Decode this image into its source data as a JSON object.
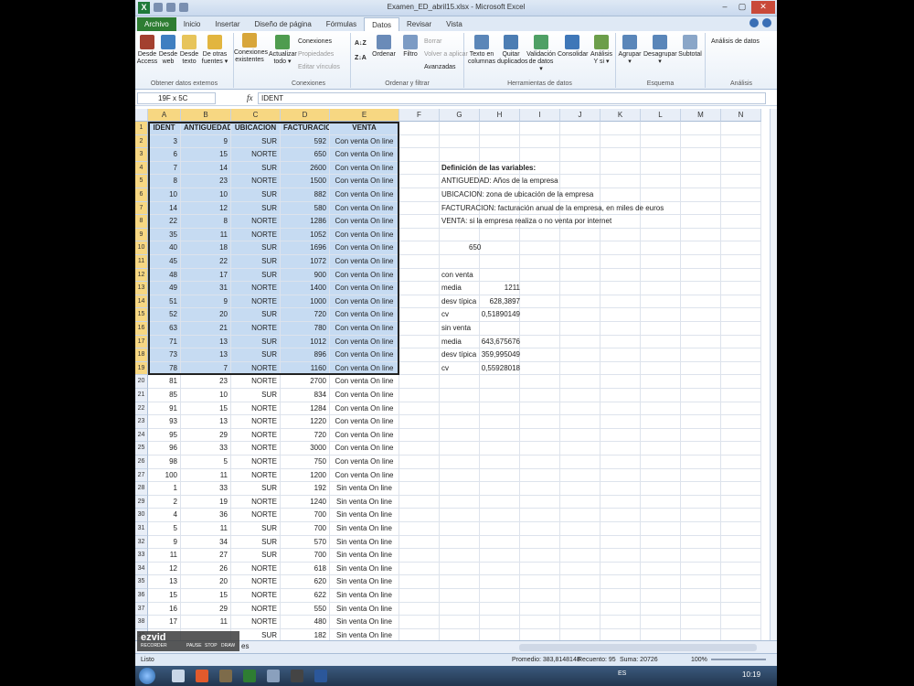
{
  "window": {
    "title": "Examen_ED_abril15.xlsx - Microsoft Excel",
    "min": "–",
    "max": "▢",
    "close": "✕"
  },
  "tabs": [
    "Archivo",
    "Inicio",
    "Insertar",
    "Diseño de página",
    "Fórmulas",
    "Datos",
    "Revisar",
    "Vista"
  ],
  "active_tab": "Datos",
  "ribbon": {
    "ext": {
      "title": "Obtener datos externos",
      "buttons": [
        {
          "l1": "Desde",
          "l2": "Access"
        },
        {
          "l1": "Desde",
          "l2": "web"
        },
        {
          "l1": "Desde",
          "l2": "texto"
        },
        {
          "l1": "De otras",
          "l2": "fuentes ▾"
        },
        {
          "l1": "Conexiones",
          "l2": "existentes"
        }
      ]
    },
    "conn": {
      "title": "Conexiones",
      "refresh1": "Actualizar",
      "refresh2": "todo ▾",
      "connections": "Conexiones",
      "properties": "Propiedades",
      "edit_links": "Editar vínculos"
    },
    "sort": {
      "title": "Ordenar y filtrar",
      "sort": "Ordenar",
      "filter": "Filtro",
      "clear": "Borrar",
      "reapply": "Volver a aplicar",
      "advanced": "Avanzadas"
    },
    "tools": {
      "title": "Herramientas de datos",
      "buttons": [
        {
          "l1": "Texto en",
          "l2": "columnas"
        },
        {
          "l1": "Quitar",
          "l2": "duplicados"
        },
        {
          "l1": "Validación",
          "l2": "de datos ▾"
        },
        {
          "l1": "Consolidar",
          "l2": ""
        },
        {
          "l1": "Análisis",
          "l2": "Y si ▾"
        }
      ]
    },
    "outline": {
      "title": "Esquema",
      "buttons": [
        {
          "l1": "Agrupar",
          "l2": "▾"
        },
        {
          "l1": "Desagrupar",
          "l2": "▾"
        },
        {
          "l1": "Subtotal",
          "l2": ""
        }
      ]
    },
    "analysis": {
      "title": "Análisis",
      "data_analysis": "Análisis de datos"
    }
  },
  "formula_bar": {
    "name_box": "19F x 5C",
    "fx": "fx",
    "content": "IDENT"
  },
  "columns": [
    "A",
    "B",
    "C",
    "D",
    "E",
    "F",
    "G",
    "H",
    "I",
    "J",
    "K",
    "L",
    "M",
    "N"
  ],
  "headers": [
    "IDENT",
    "ANTIGUEDAD",
    "UBICACION",
    "FACTURACION",
    "VENTA"
  ],
  "rows": [
    [
      "3",
      "9",
      "SUR",
      "592",
      "Con venta On line"
    ],
    [
      "6",
      "15",
      "NORTE",
      "650",
      "Con venta On line"
    ],
    [
      "7",
      "14",
      "SUR",
      "2600",
      "Con venta On line"
    ],
    [
      "8",
      "23",
      "NORTE",
      "1500",
      "Con venta On line"
    ],
    [
      "10",
      "10",
      "SUR",
      "882",
      "Con venta On line"
    ],
    [
      "14",
      "12",
      "SUR",
      "580",
      "Con venta On line"
    ],
    [
      "22",
      "8",
      "NORTE",
      "1286",
      "Con venta On line"
    ],
    [
      "35",
      "11",
      "NORTE",
      "1052",
      "Con venta On line"
    ],
    [
      "40",
      "18",
      "SUR",
      "1696",
      "Con venta On line"
    ],
    [
      "45",
      "22",
      "SUR",
      "1072",
      "Con venta On line"
    ],
    [
      "48",
      "17",
      "SUR",
      "900",
      "Con venta On line"
    ],
    [
      "49",
      "31",
      "NORTE",
      "1400",
      "Con venta On line"
    ],
    [
      "51",
      "9",
      "NORTE",
      "1000",
      "Con venta On line"
    ],
    [
      "52",
      "20",
      "SUR",
      "720",
      "Con venta On line"
    ],
    [
      "63",
      "21",
      "NORTE",
      "780",
      "Con venta On line"
    ],
    [
      "71",
      "13",
      "SUR",
      "1012",
      "Con venta On line"
    ],
    [
      "73",
      "13",
      "SUR",
      "896",
      "Con venta On line"
    ],
    [
      "78",
      "7",
      "NORTE",
      "1160",
      "Con venta On line"
    ],
    [
      "81",
      "23",
      "NORTE",
      "2700",
      "Con venta On line"
    ],
    [
      "85",
      "10",
      "SUR",
      "834",
      "Con venta On line"
    ],
    [
      "91",
      "15",
      "NORTE",
      "1284",
      "Con venta On line"
    ],
    [
      "93",
      "13",
      "NORTE",
      "1220",
      "Con venta On line"
    ],
    [
      "95",
      "29",
      "NORTE",
      "720",
      "Con venta On line"
    ],
    [
      "96",
      "33",
      "NORTE",
      "3000",
      "Con venta On line"
    ],
    [
      "98",
      "5",
      "NORTE",
      "750",
      "Con venta On line"
    ],
    [
      "100",
      "11",
      "NORTE",
      "1200",
      "Con venta On line"
    ],
    [
      "1",
      "33",
      "SUR",
      "192",
      "Sin venta On line"
    ],
    [
      "2",
      "19",
      "NORTE",
      "1240",
      "Sin venta On line"
    ],
    [
      "4",
      "36",
      "NORTE",
      "700",
      "Sin venta On line"
    ],
    [
      "5",
      "11",
      "SUR",
      "700",
      "Sin venta On line"
    ],
    [
      "9",
      "34",
      "SUR",
      "570",
      "Sin venta On line"
    ],
    [
      "11",
      "27",
      "SUR",
      "700",
      "Sin venta On line"
    ],
    [
      "12",
      "26",
      "NORTE",
      "618",
      "Sin venta On line"
    ],
    [
      "13",
      "20",
      "NORTE",
      "620",
      "Sin venta On line"
    ],
    [
      "15",
      "15",
      "NORTE",
      "622",
      "Sin venta On line"
    ],
    [
      "16",
      "29",
      "NORTE",
      "550",
      "Sin venta On line"
    ],
    [
      "17",
      "11",
      "NORTE",
      "480",
      "Sin venta On line"
    ],
    [
      "",
      "",
      "SUR",
      "182",
      "Sin venta On line"
    ]
  ],
  "definitions": {
    "title": "Definición de las variables:",
    "lines": [
      "ANTIGUEDAD: Años de la empresa",
      "UBICACION: zona de ubicación de la empresa",
      "FACTURACION: facturación anual de la empresa, en miles de euros",
      "VENTA: si la empresa realiza o no venta por internet"
    ]
  },
  "g_value": "650",
  "stats": {
    "con_label": "con venta",
    "con": [
      {
        "label": "media",
        "value": "1211"
      },
      {
        "label": "desv típica",
        "value": "628,3897"
      },
      {
        "label": "cv",
        "value": "0,51890149"
      }
    ],
    "sin_label": "sin venta",
    "sin": [
      {
        "label": "media",
        "value": "643,675676"
      },
      {
        "label": "desv típica",
        "value": "359,995049"
      },
      {
        "label": "cv",
        "value": "0,55928018"
      }
    ]
  },
  "status": {
    "mode": "Listo",
    "average": "Promedio: 383,8148148",
    "count": "Recuento: 95",
    "sum": "Suma: 20726",
    "zoom": "100%"
  },
  "sheet_tab": "es",
  "recorder": {
    "brand": "ezvid",
    "sub": "RECORDER",
    "pause": "PAUSE",
    "stop": "STOP",
    "draw": "DRAW"
  },
  "clock": "10:19",
  "lang": "ES"
}
